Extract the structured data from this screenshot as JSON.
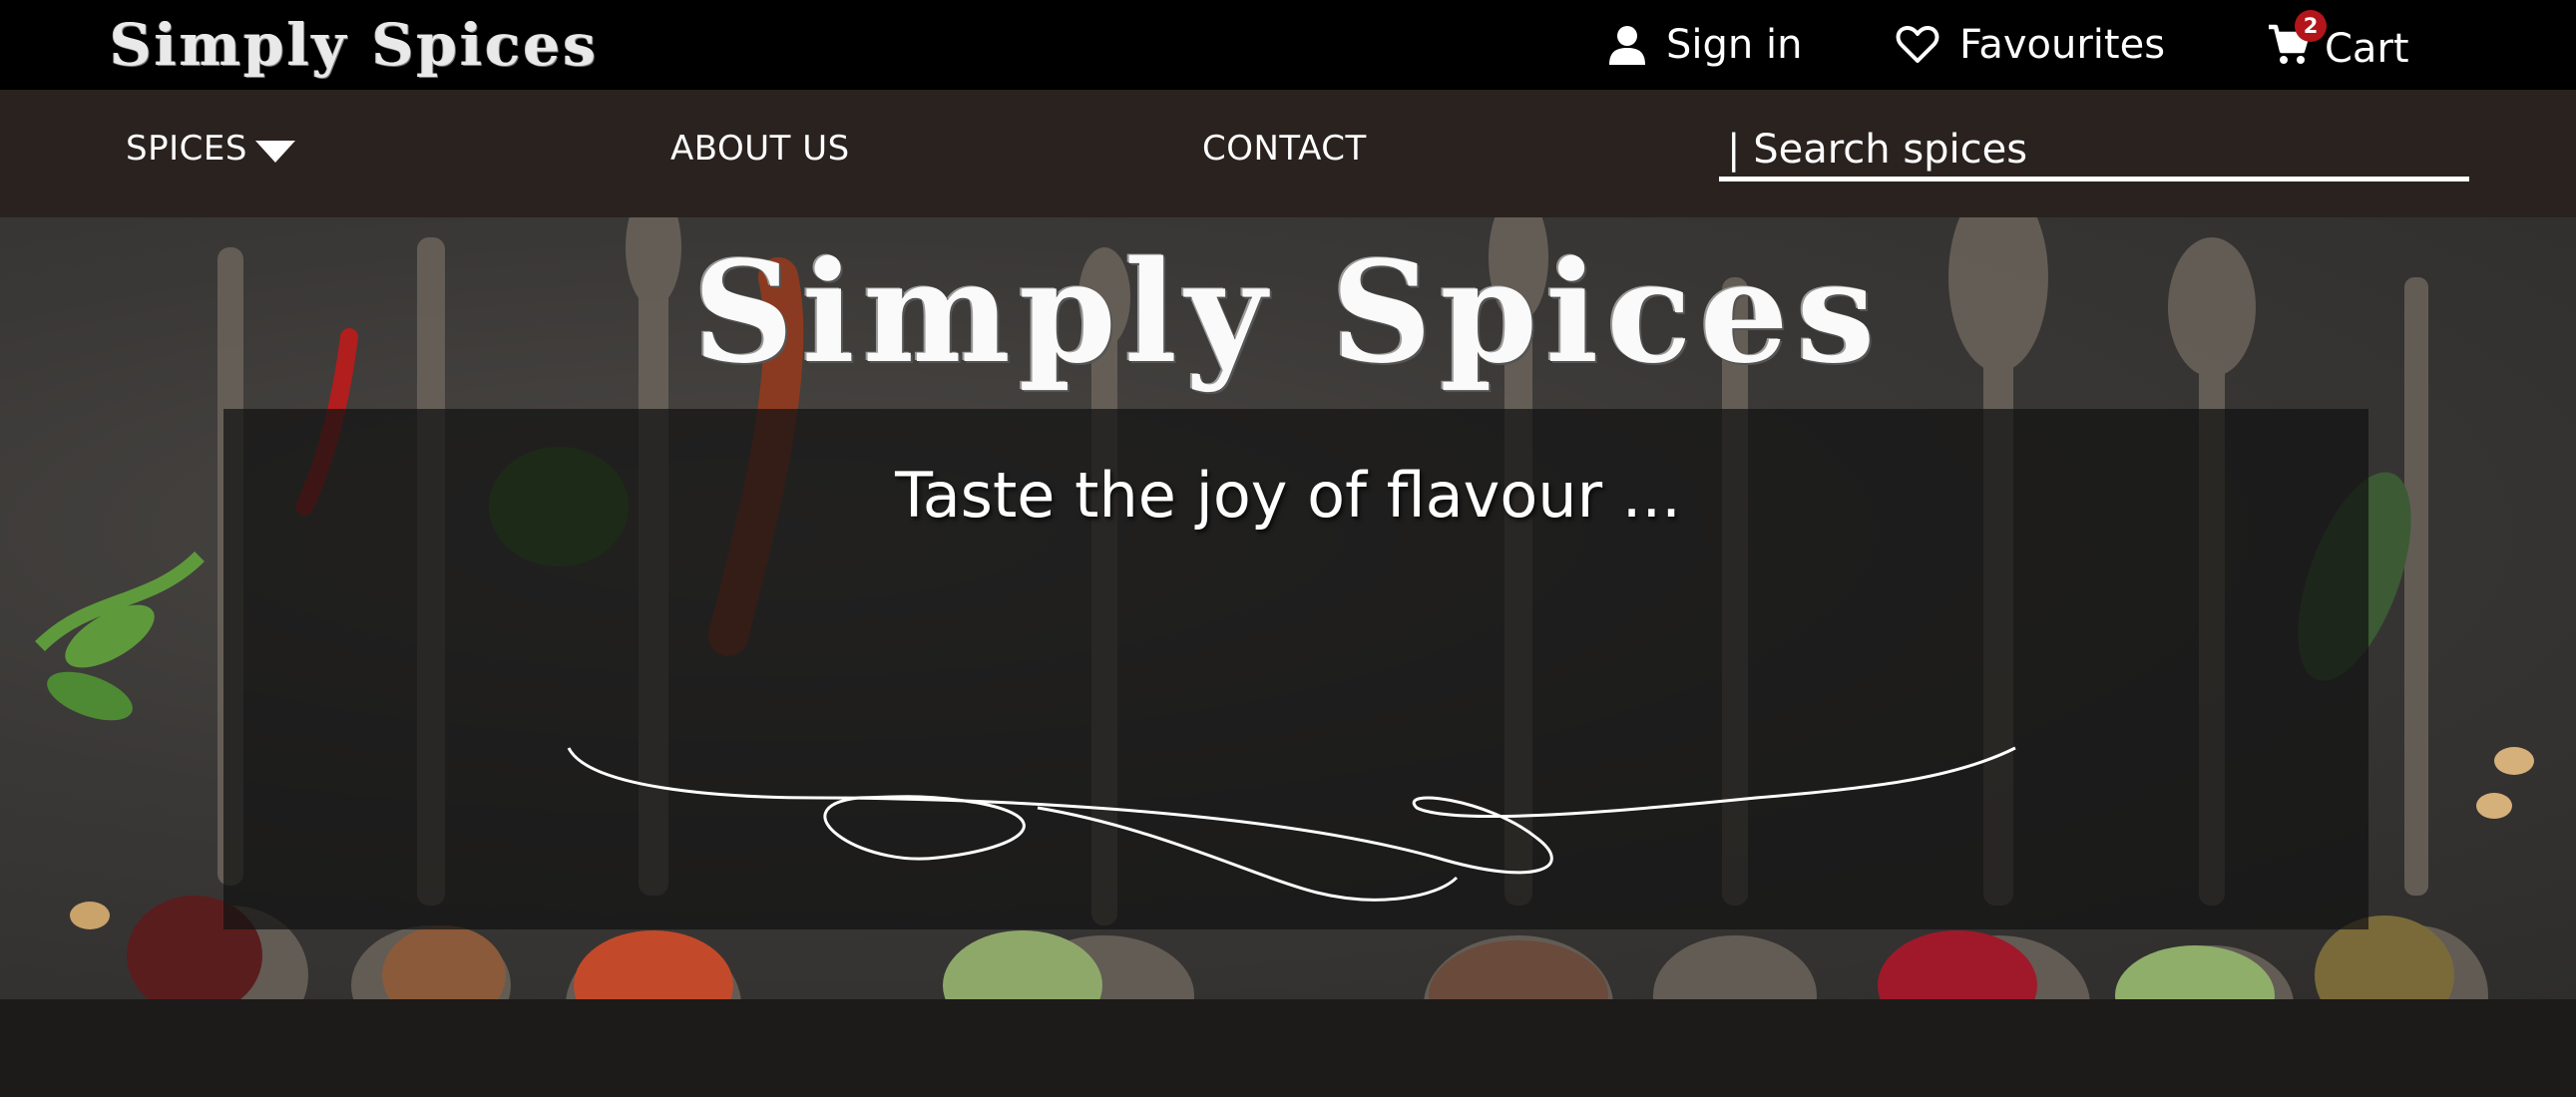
{
  "header": {
    "brand": "Simply Spices",
    "sign_in": "Sign in",
    "favourites": "Favourites",
    "cart": "Cart",
    "cart_count": "2"
  },
  "nav": {
    "spices": "SPICES",
    "about": "ABOUT US",
    "contact": "CONTACT",
    "search_placeholder": "| Search spices"
  },
  "hero": {
    "title": "Simply Spices",
    "tagline": "Taste the joy of flavour ..."
  },
  "icons": {
    "user": "person-icon",
    "heart": "heart-outline-icon",
    "cart": "shopping-cart-icon",
    "caret": "caret-down-icon"
  },
  "colors": {
    "topbar": "#000000",
    "navbar": "#2a221f",
    "badge": "#b3151a",
    "text": "#ffffff"
  }
}
